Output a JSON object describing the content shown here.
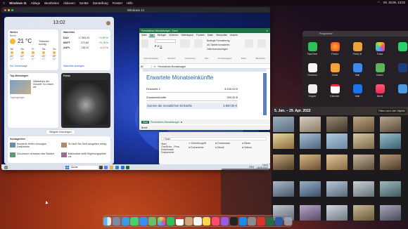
{
  "menubar": {
    "app": "Windows 11",
    "items": [
      "Ablage",
      "Bearbeiten",
      "Aktionen",
      "Geräte",
      "Darstellung",
      "Fenster",
      "Hilfe"
    ],
    "right": "Mi. 18.05. 13:02"
  },
  "vm": {
    "title": "Windows 11",
    "widgets": {
      "time": "13:02",
      "weather": {
        "title": "Wetter",
        "location": "Berlin",
        "temp": "21 °C",
        "desc": "Teilweise sonnig",
        "days": [
          "Mi",
          "Do",
          "Fr",
          "Sa",
          "So"
        ],
        "highs": [
          "24°",
          "22°",
          "21°",
          "23°",
          "25°"
        ],
        "lows": [
          "12°",
          "11°",
          "10°",
          "13°",
          "14°"
        ],
        "link": "Zur Vorhersage"
      },
      "watchlist": {
        "title": "Watchlist",
        "rows": [
          {
            "name": "DAX",
            "value": "17.583,00",
            "change": "+0,59 %"
          },
          {
            "name": "MSFT",
            "value": "270,85",
            "change": "+0,78 %"
          },
          {
            "name": "AAPL",
            "value": "138,32",
            "change": "-0,12 %"
          }
        ],
        "link": "Watchlist anzeigen"
      },
      "news_card": {
        "title": "Top-Meldungen",
        "headline": "Städtetrips der Zukunft: So reisen wir",
        "source": "Tagesspiegel"
      },
      "photo_card": {
        "title": "Fotos"
      },
      "add_button": "Widgets hinzufügen",
      "feed": {
        "title": "Schlagzeilen",
        "items": [
          {
            "headline": "Hunderte Helfer versorgen Geflüchtete",
            "source": "Spiegel"
          },
          {
            "headline": "So läuft Sie Geld ausgeben richtig",
            "source": "Focus"
          },
          {
            "headline": "Zuschauer verlassen das Stadion",
            "source": "Sport1"
          },
          {
            "headline": "Nationalrat stellt Regierungspläne vor",
            "source": "Welt"
          }
        ]
      }
    },
    "taskbar": {
      "search": "Suche",
      "time": "13:02",
      "date": "18.05.2022",
      "lang": "DEU"
    },
    "excel": {
      "title": "Persönliches Monatsbudget - Excel",
      "menu": [
        "Datei",
        "Start",
        "Einfügen",
        "Zeichnen",
        "Seitenlayout",
        "Formeln",
        "Daten",
        "Überprüfen",
        "Ansicht"
      ],
      "ribbon_groups": [
        "Zwischenablage",
        "Schriftart",
        "Ausrichtung",
        "Zahl",
        "Formatvorlagen",
        "Zellen",
        "Bearbeiten"
      ],
      "ribbon_items": [
        "Bedingte Formatierung",
        "Als Tabelle formatieren",
        "Zellenformatvorlagen"
      ],
      "cell_ref": "B2",
      "formula": "Persönliches Monatsbudget",
      "heading": "Erwartete Monatseinkünfte",
      "rows": [
        {
          "label": "Einkünfte 1",
          "value": "4.200,00 €"
        },
        {
          "label": "Zusatzeinkünfte",
          "value": "300,00 €"
        },
        {
          "label": "Summe der monatlichen Einkünfte",
          "value": "4.500,00 €"
        }
      ],
      "sheet_tabs": [
        "Start",
        "Persönliches Monatsbudget"
      ],
      "status": "Bereit"
    },
    "explorer": {
      "path": "Start",
      "sidebar": [
        "Start",
        "OneDrive - Pers",
        "Downloads",
        "Dokumente"
      ],
      "items": [
        "Schnellzugriff",
        "Downloads",
        "Bilder",
        "Dokumente",
        "Musik",
        "Videos"
      ]
    }
  },
  "apps_folder": {
    "title": "Programme",
    "row1": [
      "FaceTime",
      "Firefox",
      "Firefly III",
      "Fotos"
    ],
    "row2": [
      "Freeform",
      "Home",
      "Mail",
      "Karten"
    ],
    "row3": [
      "Hopper",
      "Kalender",
      "Mail",
      "Musik"
    ]
  },
  "photos": {
    "range": "5. Jan. – 29. Apr. 2022",
    "filter": "Filtern nach: Alle Objekte"
  },
  "dock": {
    "icons": [
      "finder",
      "launchpad",
      "safari",
      "messages",
      "mail",
      "maps",
      "photos",
      "facetime",
      "calendar",
      "contacts",
      "reminders",
      "notes",
      "music",
      "podcasts",
      "tv",
      "appstore",
      "settings",
      "parallels",
      "excel",
      "word",
      "trash"
    ]
  }
}
